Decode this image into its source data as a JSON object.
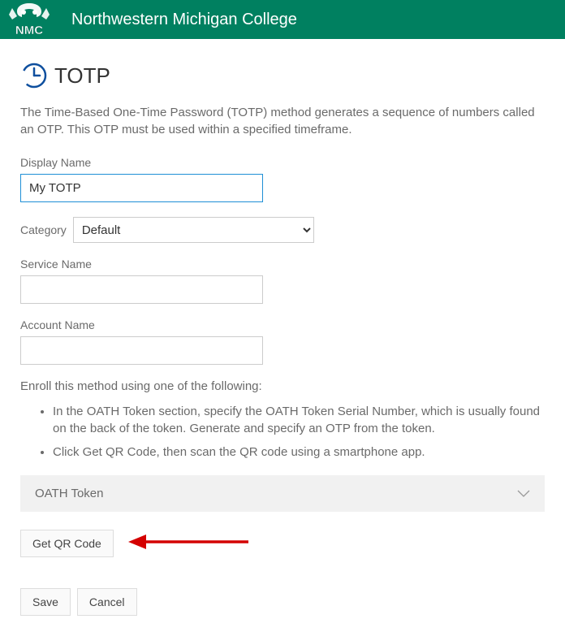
{
  "header": {
    "org_name": "Northwestern Michigan College",
    "logo_text": "NMC"
  },
  "page": {
    "title": "TOTP",
    "description": "The Time-Based One-Time Password (TOTP) method generates a sequence of numbers called an OTP. This OTP must be used within a specified timeframe."
  },
  "form": {
    "display_name_label": "Display Name",
    "display_name_value": "My TOTP",
    "category_label": "Category",
    "category_value": "Default",
    "service_name_label": "Service Name",
    "service_name_value": "",
    "account_name_label": "Account Name",
    "account_name_value": ""
  },
  "enroll": {
    "intro": "Enroll this method using one of the following:",
    "item1": "In the OATH Token section, specify the OATH Token Serial Number, which is usually found on the back of the token. Generate and specify an OTP from the token.",
    "item2": "Click Get QR Code, then scan the QR code using a smartphone app."
  },
  "accordion": {
    "oath_token_label": "OATH Token"
  },
  "buttons": {
    "get_qr": "Get QR Code",
    "save": "Save",
    "cancel": "Cancel"
  }
}
